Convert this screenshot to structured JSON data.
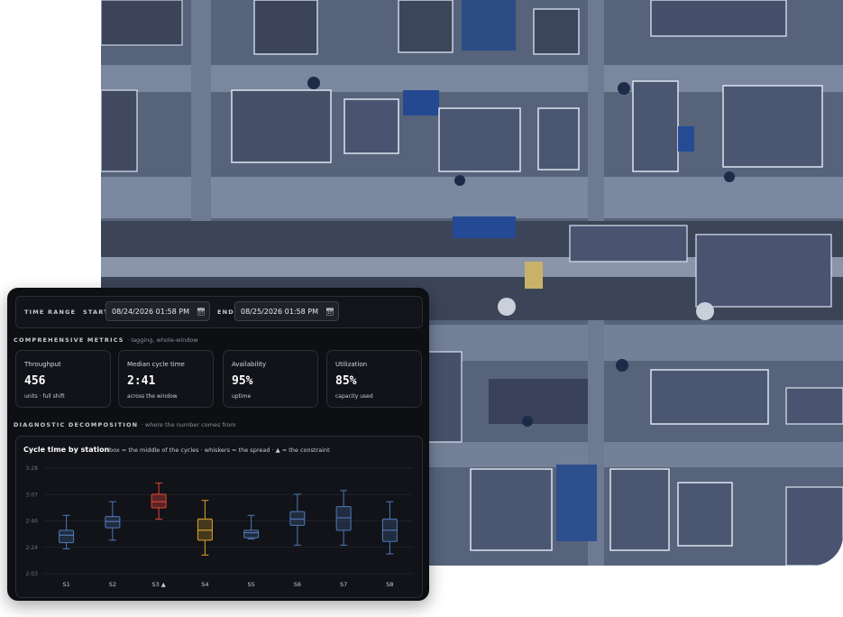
{
  "time_range": {
    "label": "TIME RANGE",
    "start_label": "START",
    "start_value": "08/24/2026 01:58 PM",
    "end_label": "END",
    "end_value": "08/25/2026 01:58 PM",
    "calendar_icon": "calendar-icon"
  },
  "comprehensive": {
    "title": "COMPREHENSIVE METRICS",
    "subtitle": "· lagging, whole-window"
  },
  "metrics": [
    {
      "label": "Throughput",
      "value": "456",
      "sub": "units · full shift"
    },
    {
      "label": "Median cycle time",
      "value": "2:41",
      "sub": "across the window"
    },
    {
      "label": "Availability",
      "value": "95%",
      "sub": "uptime"
    },
    {
      "label": "Utilization",
      "value": "85%",
      "sub": "capacity used"
    }
  ],
  "diagnostic": {
    "title": "DIAGNOSTIC DECOMPOSITION",
    "subtitle": "· where the number comes from"
  },
  "chart_data": {
    "type": "box",
    "title": "Cycle time by station",
    "subtitle": "box = the middle of the cycles · whiskers = the spread · ▲ = the constraint",
    "y_ticks": [
      "3:28",
      "3:07",
      "2:46",
      "2:24",
      "2:03"
    ],
    "ylim_seconds": [
      123,
      208
    ],
    "colors": {
      "normal": "#4f79b8",
      "constraint": "#e0453a",
      "warning": "#e0a52a"
    },
    "stations": [
      {
        "name": "S1",
        "min": 143,
        "q1": 148,
        "median": 154,
        "q3": 158,
        "max": 170,
        "status": "normal"
      },
      {
        "name": "S2",
        "min": 150,
        "q1": 160,
        "median": 165,
        "q3": 169,
        "max": 181,
        "status": "normal"
      },
      {
        "name": "S3 ▲",
        "min": 167,
        "q1": 176,
        "median": 181,
        "q3": 187,
        "max": 196,
        "status": "constraint"
      },
      {
        "name": "S4",
        "min": 138,
        "q1": 150,
        "median": 158,
        "q3": 167,
        "max": 182,
        "status": "warning"
      },
      {
        "name": "S5",
        "min": 151,
        "q1": 152,
        "median": 156,
        "q3": 158,
        "max": 170,
        "status": "normal"
      },
      {
        "name": "S6",
        "min": 146,
        "q1": 162,
        "median": 167,
        "q3": 173,
        "max": 187,
        "status": "normal"
      },
      {
        "name": "S7",
        "min": 146,
        "q1": 158,
        "median": 168,
        "q3": 177,
        "max": 190,
        "status": "normal"
      },
      {
        "name": "S8",
        "min": 139,
        "q1": 149,
        "median": 158,
        "q3": 167,
        "max": 181,
        "status": "normal"
      }
    ]
  }
}
